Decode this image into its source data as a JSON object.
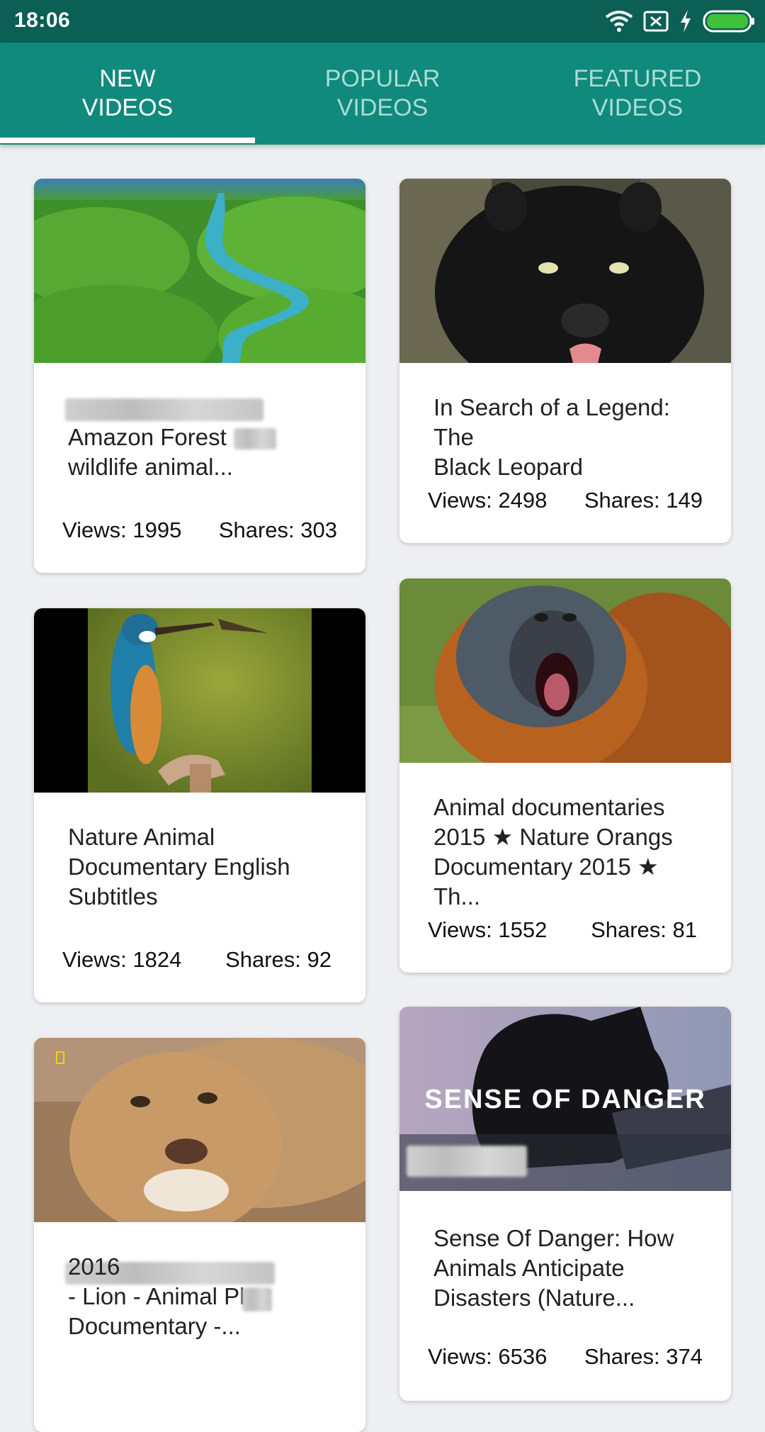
{
  "status_bar": {
    "time": "18:06",
    "icons": [
      "wifi-icon",
      "no-sim-icon",
      "charging-icon",
      "battery-icon"
    ],
    "battery_color": "#3ec23a"
  },
  "tabs": [
    {
      "label": "NEW\nVIDEOS",
      "active": true
    },
    {
      "label": "POPULAR\nVIDEOS",
      "active": false
    },
    {
      "label": "FEATURED\nVIDEOS",
      "active": false
    }
  ],
  "colors": {
    "status_bar": "#0b5f55",
    "tab_bar": "#0f8a7c",
    "background": "#eeeff3"
  },
  "videos": [
    {
      "title": "Amazon Forest\nwildlife animal...",
      "views": "Views: 1995",
      "shares": "Shares: 303"
    },
    {
      "title": "In Search of a Legend: The\nBlack Leopard",
      "views": "Views: 2498",
      "shares": "Shares: 149"
    },
    {
      "title": "Nature Animal\nDocumentary English\nSubtitles",
      "views": "Views: 1824",
      "shares": "Shares: 92"
    },
    {
      "title": "Animal documentaries\n2015 ★ Nature Orangs\nDocumentary 2015 ★ Th...",
      "views": "Views: 1552",
      "shares": "Shares: 81"
    },
    {
      "title": "2016\n- Lion - Animal Pla    t\nDocumentary -...",
      "views": "",
      "shares": ""
    },
    {
      "title": "Sense Of Danger: How\nAnimals Anticipate\nDisasters (Nature...",
      "views": "Views: 6536",
      "shares": "Shares: 374",
      "thumbnail_text": "SENSE OF DANGER"
    }
  ]
}
